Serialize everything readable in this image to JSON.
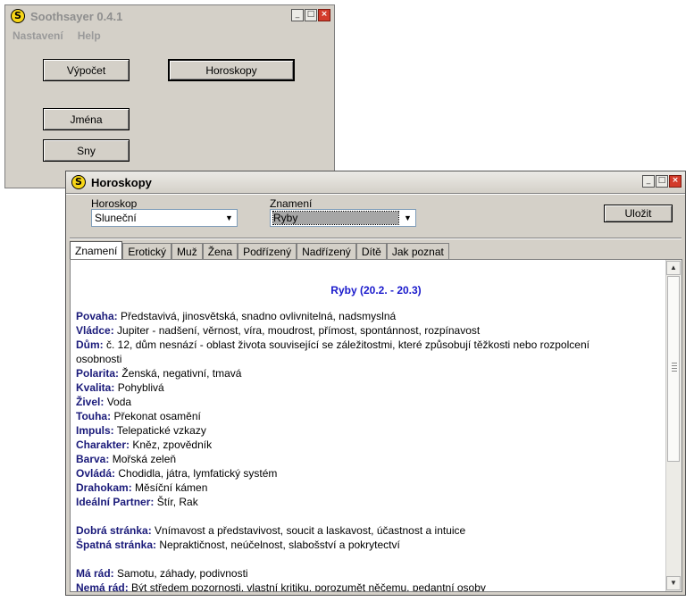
{
  "main_window": {
    "title": "Soothsayer 0.4.1",
    "menu": [
      "Nastavení",
      "Help"
    ],
    "buttons": {
      "vypocet": "Výpočet",
      "horoskopy": "Horoskopy",
      "jmena": "Jména",
      "sny": "Sny"
    }
  },
  "horoscope_window": {
    "title": "Horoskopy",
    "horoskop_label": "Horoskop",
    "horoskop_value": "Sluneční",
    "znameni_label": "Znamení",
    "znameni_value": "Ryby",
    "save_label": "Uložit",
    "tabs": [
      "Znamení",
      "Erotický",
      "Muž",
      "Žena",
      "Podřízený",
      "Nadřízený",
      "Dítě",
      "Jak poznat"
    ],
    "heading": "Ryby (20.2. - 20.3)",
    "lines": [
      {
        "key": "Povaha:",
        "text": "Představivá, jinosvětská, snadno ovlivnitelná, nadsmyslná"
      },
      {
        "key": "Vládce:",
        "text": "Jupiter - nadšení, věrnost, víra, moudrost, přímost, spontánnost, rozpínavost"
      },
      {
        "key": "Dům:",
        "text": "č. 12, dům nesnází - oblast života související se záležitostmi, které způsobují těžkosti nebo rozpolcení"
      },
      {
        "key": "",
        "text": "osobnosti"
      },
      {
        "key": "Polarita:",
        "text": "Ženská, negativní, tmavá"
      },
      {
        "key": "Kvalita:",
        "text": "Pohyblivá"
      },
      {
        "key": "Živel:",
        "text": "Voda"
      },
      {
        "key": "Touha:",
        "text": "Překonat osamění"
      },
      {
        "key": "Impuls:",
        "text": "Telepatické vzkazy"
      },
      {
        "key": "Charakter:",
        "text": "Kněz, zpovědník"
      },
      {
        "key": "Barva:",
        "text": "Mořská zeleň"
      },
      {
        "key": "Ovládá:",
        "text": "Chodidla, játra, lymfatický systém"
      },
      {
        "key": "Drahokam:",
        "text": "Měsíční kámen"
      },
      {
        "key": "Ideální Partner:",
        "text": "Štír, Rak"
      },
      {
        "key": "",
        "text": ""
      },
      {
        "key": "Dobrá stránka:",
        "text": "Vnímavost a představivost, soucit a laskavost, účastnost a intuice"
      },
      {
        "key": "Špatná stránka:",
        "text": "Nepraktičnost, neúčelnost, slabošství a pokrytectví"
      },
      {
        "key": "",
        "text": ""
      },
      {
        "key": "Má rád:",
        "text": "Samotu, záhady, podivnosti"
      },
      {
        "key": "Nemá rád:",
        "text": "Být středem pozornosti, vlastní kritiku, porozumět něčemu, pedantní osoby"
      }
    ]
  }
}
